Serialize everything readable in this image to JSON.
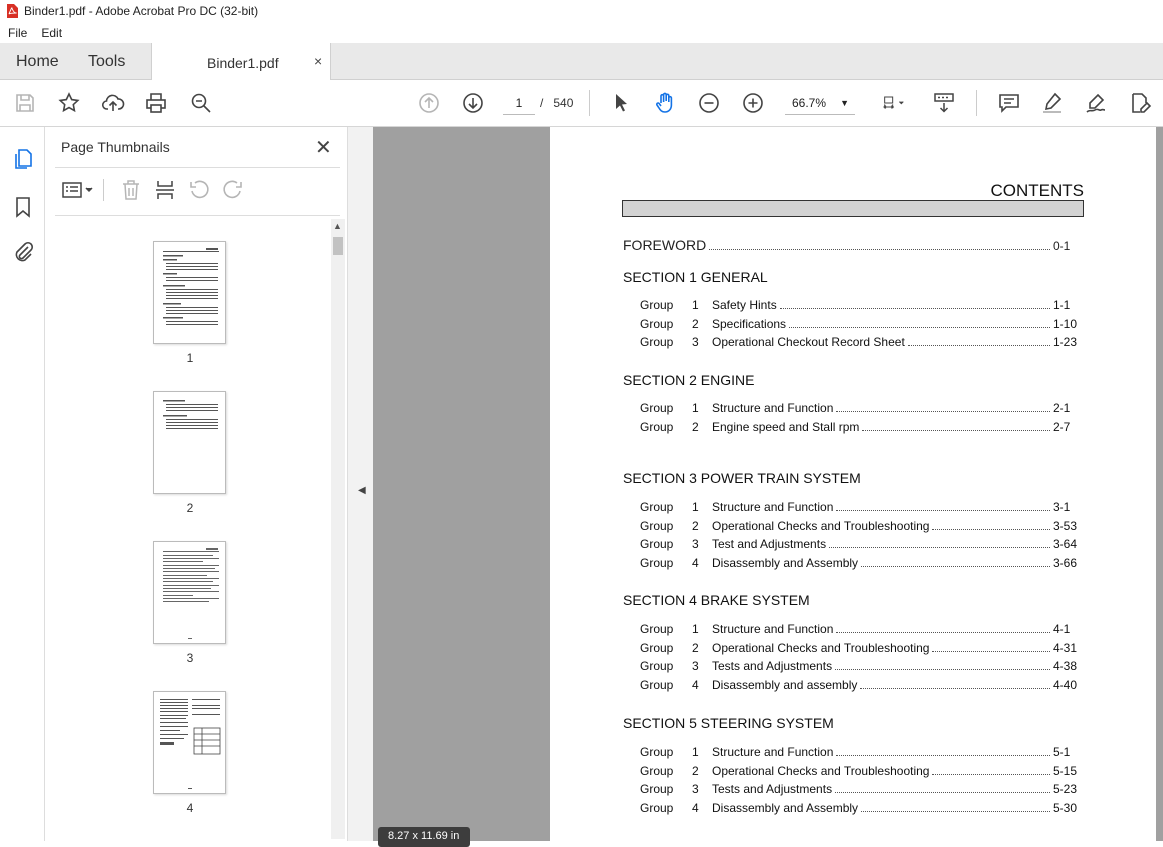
{
  "window": {
    "title": "Binder1.pdf - Adobe Acrobat Pro DC (32-bit)"
  },
  "menu": {
    "file": "File",
    "edit": "Edit"
  },
  "tabs": {
    "home": "Home",
    "tools": "Tools",
    "document": "Binder1.pdf",
    "close": "×"
  },
  "toolbar": {
    "page_current": "1",
    "page_sep": "/",
    "page_total": "540",
    "zoom": "66.7%"
  },
  "panel": {
    "title": "Page Thumbnails",
    "thumbnails": [
      "1",
      "2",
      "3",
      "4"
    ]
  },
  "status": {
    "dimensions": "8.27 x 11.69 in"
  },
  "document": {
    "title": "CONTENTS",
    "foreword": {
      "label": "FOREWORD",
      "page": "0-1"
    },
    "sections": [
      {
        "heading": "SECTION 1  GENERAL",
        "groups": [
          {
            "group": "Group",
            "num": "1",
            "title": "Safety Hints",
            "page": "1-1"
          },
          {
            "group": "Group",
            "num": "2",
            "title": "Specifications",
            "page": "1-10"
          },
          {
            "group": "Group",
            "num": "3",
            "title": "Operational Checkout Record Sheet",
            "page": "1-23"
          }
        ]
      },
      {
        "heading": "SECTION 2  ENGINE",
        "groups": [
          {
            "group": "Group",
            "num": "1",
            "title": "Structure and Function",
            "page": "2-1"
          },
          {
            "group": "Group",
            "num": "2",
            "title": "Engine speed and Stall rpm",
            "page": "2-7"
          }
        ]
      },
      {
        "heading": "SECTION 3  POWER TRAIN SYSTEM",
        "groups": [
          {
            "group": "Group",
            "num": "1",
            "title": "Structure and Function",
            "page": "3-1"
          },
          {
            "group": "Group",
            "num": "2",
            "title": "Operational Checks and Troubleshooting",
            "page": "3-53"
          },
          {
            "group": "Group",
            "num": "3",
            "title": "Test and Adjustments",
            "page": "3-64"
          },
          {
            "group": "Group",
            "num": "4",
            "title": "Disassembly and Assembly",
            "page": "3-66"
          }
        ]
      },
      {
        "heading": "SECTION 4  BRAKE SYSTEM",
        "groups": [
          {
            "group": "Group",
            "num": "1",
            "title": "Structure and Function",
            "page": "4-1"
          },
          {
            "group": "Group",
            "num": "2",
            "title": "Operational Checks and Troubleshooting",
            "page": "4-31"
          },
          {
            "group": "Group",
            "num": "3",
            "title": "Tests and Adjustments",
            "page": "4-38"
          },
          {
            "group": "Group",
            "num": "4",
            "title": "Disassembly and assembly",
            "page": "4-40"
          }
        ]
      },
      {
        "heading": "SECTION 5  STEERING SYSTEM",
        "groups": [
          {
            "group": "Group",
            "num": "1",
            "title": "Structure and Function",
            "page": "5-1"
          },
          {
            "group": "Group",
            "num": "2",
            "title": "Operational Checks and Troubleshooting",
            "page": "5-15"
          },
          {
            "group": "Group",
            "num": "3",
            "title": "Tests and Adjustments",
            "page": "5-23"
          },
          {
            "group": "Group",
            "num": "4",
            "title": "Disassembly and Assembly",
            "page": "5-30"
          }
        ]
      }
    ]
  },
  "icons": {
    "toolbar": [
      "save-icon",
      "bookmark-star-icon",
      "upload-icon",
      "print-icon",
      "zoom-search-icon",
      "page-up-icon",
      "page-down-icon",
      "select-cursor-icon",
      "hand-icon",
      "zoom-out-icon",
      "zoom-in-icon",
      "page-fit-icon",
      "scroll-mode-icon",
      "comment-icon",
      "highlight-pen-icon",
      "sign-icon",
      "edit-pdf-icon"
    ],
    "rail": [
      "page-thumbnails-icon",
      "bookmarks-icon",
      "attachments-icon"
    ]
  },
  "colors": {
    "accent": "#1473e6",
    "pdf_red": "#d83025",
    "gray_area": "#a0a0a0"
  }
}
